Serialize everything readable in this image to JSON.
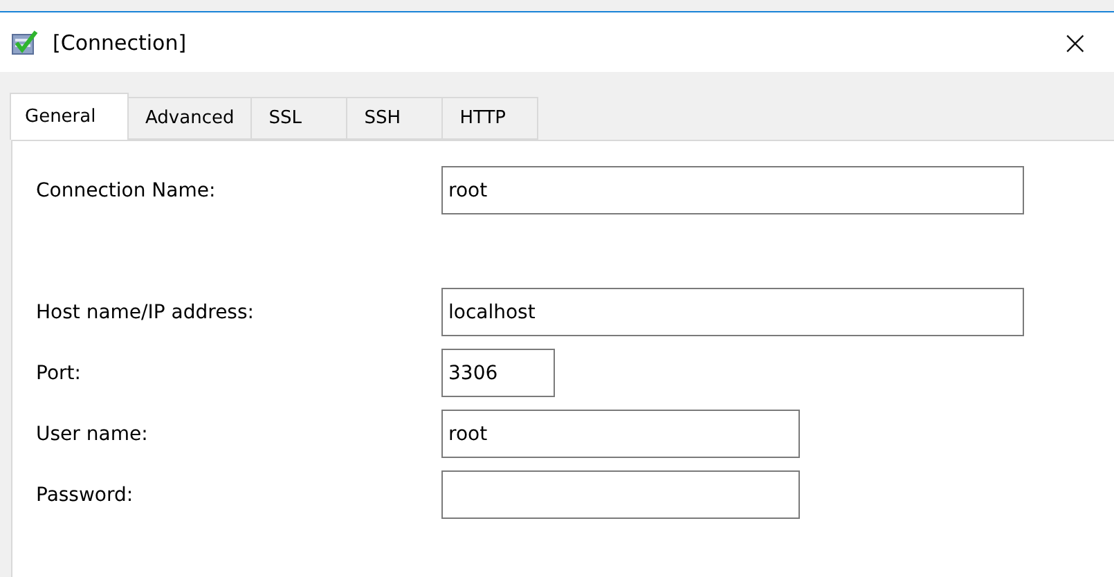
{
  "window": {
    "title": "[Connection]",
    "close": "×"
  },
  "tabs": [
    {
      "label": "General",
      "selected": true
    },
    {
      "label": "Advanced",
      "selected": false
    },
    {
      "label": "SSL",
      "selected": false
    },
    {
      "label": "SSH",
      "selected": false
    },
    {
      "label": "HTTP",
      "selected": false
    }
  ],
  "fields": [
    {
      "label": "Connection Name:",
      "value": "root"
    },
    {
      "label": "Host name/IP address:",
      "value": "localhost"
    },
    {
      "label": "Port:",
      "value": "3306"
    },
    {
      "label": "User name:",
      "value": "root"
    },
    {
      "label": "Password:"
    }
  ]
}
